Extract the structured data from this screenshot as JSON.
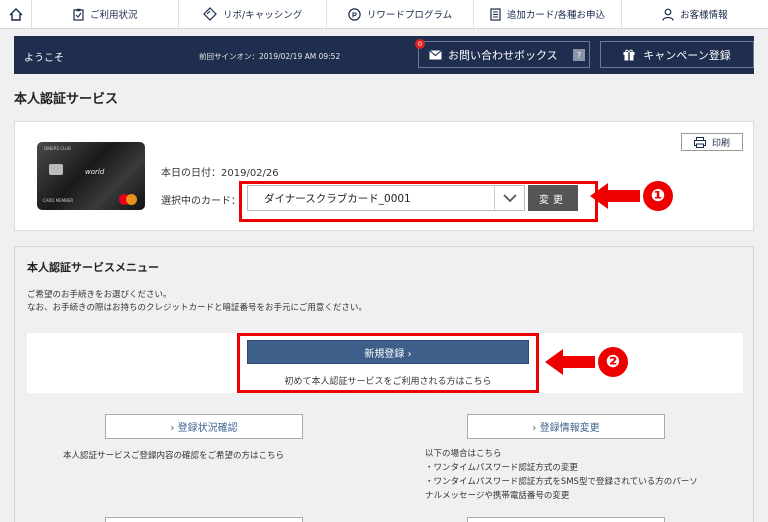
{
  "topnav": {
    "home_icon": "home-icon",
    "items": [
      {
        "label": "ご利用状況",
        "icon": "clipboard-icon"
      },
      {
        "label": "リボ/キャッシング",
        "icon": "diamond-icon"
      },
      {
        "label": "リワードプログラム",
        "icon": "points-icon"
      },
      {
        "label": "追加カード/各種お申込",
        "icon": "document-icon"
      },
      {
        "label": "お客様情報",
        "icon": "user-icon"
      }
    ]
  },
  "header": {
    "welcome": "ようこそ",
    "last_signin": "前回サインオン：2019/02/19 AM 09:52",
    "inquiry_label": "お問い合わせボックス",
    "inquiry_badge": "0",
    "help_label": "?",
    "campaign_label": "キャンペーン登録"
  },
  "page_title": "本人認証サービス",
  "card_panel": {
    "print_label": "印刷",
    "card_brand_text": "DINERS CLUB",
    "card_name_text": "world",
    "card_member_text": "CARD MEMBER",
    "today_label": "本日の日付：2019/02/26",
    "selected_card_label": "選択中のカード：",
    "selected_card_value": "ダイナースクラブカード_0001",
    "change_label": "変更",
    "annotation_number": "❶"
  },
  "menu": {
    "title": "本人認証サービスメニュー",
    "desc_line1": "ご希望のお手続きをお選びください。",
    "desc_line2": "なお、お手続きの際はお持ちのクレジットカードと暗証番号をお手元にご用意ください。",
    "new_registration_label": "新規登録 ›",
    "new_registration_sub": "初めて本人認証サービスをご利用される方はこちら",
    "annotation_number": "❷",
    "status_check_label": "› 登録状況確認",
    "status_check_desc": "本人認証サービスご登録内容の確認をご希望の方はこちら",
    "info_change_label": "› 登録情報変更",
    "info_change_desc_lines": [
      "以下の場合はこちら",
      "・ワンタイムパスワード認証方式の変更",
      "・ワンタイムパスワード認証方式をSMS型で登録されている方のパーソ",
      "ナルメッセージや携帯電話番号の変更"
    ]
  },
  "colors": {
    "header_bg": "#1f2d4e",
    "annotation_red": "#e00000",
    "primary_button": "#3e5f8a"
  }
}
